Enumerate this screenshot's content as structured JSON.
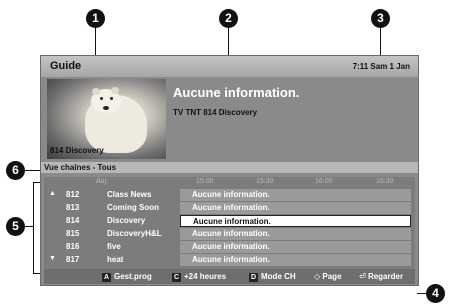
{
  "header": {
    "title": "Guide",
    "datetime": "7:11 Sam 1 Jan"
  },
  "preview": {
    "channel_label": "814 Discovery"
  },
  "info": {
    "title": "Aucune information.",
    "subtitle": "TV TNT 814 Discovery"
  },
  "channel_bar": {
    "label": "Vue chaînes - Tous"
  },
  "timeline": [
    "Auj.",
    "15:00",
    "15:30",
    "16:00",
    "16:30"
  ],
  "rows": [
    {
      "arrow": "▲",
      "num": "812",
      "name": "Class News",
      "program": "Aucune information."
    },
    {
      "arrow": "",
      "num": "813",
      "name": "Coming Soon",
      "program": "Aucune information."
    },
    {
      "arrow": "",
      "num": "814",
      "name": "Discovery",
      "program": "Aucune information."
    },
    {
      "arrow": "",
      "num": "815",
      "name": "DiscoveryH&L",
      "program": "Aucune information."
    },
    {
      "arrow": "",
      "num": "816",
      "name": "five",
      "program": "Aucune information."
    },
    {
      "arrow": "▼",
      "num": "817",
      "name": "heat",
      "program": "Aucune information."
    }
  ],
  "footer": {
    "a_key": "A",
    "a_label": "Gest.prog",
    "c_key": "C",
    "c_label": "+24 heures",
    "d_key": "D",
    "d_label": "Mode CH",
    "page_icon": "◇",
    "page_label": "Page",
    "watch_icon": "⏎",
    "watch_label": "Regarder"
  },
  "callouts": [
    "1",
    "2",
    "3",
    "4",
    "5",
    "6"
  ],
  "icons": {
    "up": "triangle-up-icon",
    "down": "triangle-down-icon",
    "page": "diamond-icon",
    "watch": "enter-icon"
  }
}
